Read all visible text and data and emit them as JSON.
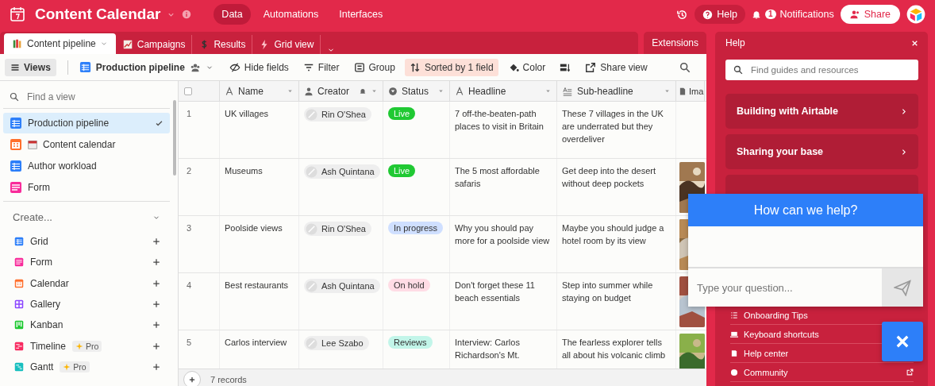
{
  "app": {
    "title": "Content Calendar",
    "nav": [
      {
        "label": "Data",
        "selected": true
      },
      {
        "label": "Automations",
        "selected": false
      },
      {
        "label": "Interfaces",
        "selected": false
      }
    ],
    "help_button": "Help",
    "notifications": {
      "count": "1",
      "label": "Notifications"
    },
    "share_button": "Share"
  },
  "table_tabs": [
    {
      "kind": "books",
      "label": "Content pipeline",
      "selected": true
    },
    {
      "kind": "chart",
      "label": "Campaigns",
      "selected": false
    },
    {
      "kind": "coin",
      "label": "Results",
      "selected": false
    },
    {
      "kind": "bolt",
      "label": "Grid view",
      "selected": false
    }
  ],
  "extensions_tab": "Extensions",
  "toolbar": {
    "views_button": "Views",
    "current_view": "Production pipeline",
    "actions": [
      {
        "kind": "hide",
        "label": "Hide fields",
        "active": false
      },
      {
        "kind": "filter",
        "label": "Filter",
        "active": false
      },
      {
        "kind": "group",
        "label": "Group",
        "active": false
      },
      {
        "kind": "sort",
        "label": "Sorted by 1 field",
        "active": true
      },
      {
        "kind": "color",
        "label": "Color",
        "active": false
      },
      {
        "kind": "rowheight",
        "active": false
      },
      {
        "kind": "share",
        "label": "Share view",
        "active": false
      }
    ]
  },
  "sidebar": {
    "search_placeholder": "Find a view",
    "views": [
      {
        "kind": "grid",
        "label": "Production pipeline",
        "selected": true
      },
      {
        "kind": "calendar",
        "label": "Content calendar",
        "selected": false
      },
      {
        "kind": "grid",
        "label": "Author workload",
        "selected": false
      },
      {
        "kind": "form",
        "label": "Form",
        "selected": false
      }
    ],
    "create_label": "Create...",
    "create_items": [
      {
        "kind": "grid",
        "label": "Grid"
      },
      {
        "kind": "form",
        "label": "Form"
      },
      {
        "kind": "calendar",
        "label": "Calendar"
      },
      {
        "kind": "gallery",
        "label": "Gallery"
      },
      {
        "kind": "kanban",
        "label": "Kanban"
      },
      {
        "kind": "timeline",
        "label": "Timeline",
        "badge": "Pro"
      },
      {
        "kind": "gantt",
        "label": "Gantt",
        "badge": "Pro"
      }
    ]
  },
  "table": {
    "columns": [
      {
        "kind": "text",
        "label": "Name"
      },
      {
        "kind": "user",
        "label": "Creator"
      },
      {
        "kind": "status",
        "label": "Status"
      },
      {
        "kind": "text",
        "label": "Headline"
      },
      {
        "kind": "longtext",
        "label": "Sub-headline"
      },
      {
        "kind": "attachment",
        "label": "Ima"
      }
    ],
    "rows": [
      {
        "number": "1",
        "name": "UK villages",
        "creator": "Rin O'Shea",
        "status": {
          "label": "Live",
          "color": "#20c933"
        },
        "headline": "7 off-the-beaten-path places to visit in Britain",
        "subheadline": "These 7 villages in the UK are underrated but they overdeliver"
      },
      {
        "number": "2",
        "name": "Museums",
        "creator": "Ash Quintana",
        "status": {
          "label": "Live",
          "color": "#20c933"
        },
        "headline": "The 5 most affordable safaris",
        "subheadline": "Get deep into the desert without deep pockets"
      },
      {
        "number": "3",
        "name": "Poolside views",
        "creator": "Rin O'Shea",
        "status": {
          "label": "In progress",
          "color": "#cfdfff"
        },
        "headline": "Why you should pay more for a poolside view",
        "subheadline": "Maybe you should judge a hotel room by its view"
      },
      {
        "number": "4",
        "name": "Best restaurants",
        "creator": "Ash Quintana",
        "status": {
          "label": "On hold",
          "color": "#ffdce5"
        },
        "headline": "Don't forget these 11 beach essentials",
        "subheadline": "Step into summer while staying on budget"
      },
      {
        "number": "5",
        "name": "Carlos interview",
        "creator": "Lee Szabo",
        "status": {
          "label": "Reviews",
          "color": "#c2f5e9"
        },
        "headline": "Interview: Carlos Richardson's Mt.",
        "subheadline": "The fearless explorer tells all about his volcanic climb"
      }
    ],
    "record_count": "7 records"
  },
  "help_panel": {
    "title": "Help",
    "search_placeholder": "Find guides and resources",
    "cards": [
      "Building with Airtable",
      "Sharing your base"
    ],
    "links": [
      {
        "kind": "tips",
        "label": "Onboarding Tips",
        "external": false
      },
      {
        "kind": "keyboard",
        "label": "Keyboard shortcuts",
        "external": false
      },
      {
        "kind": "book",
        "label": "Help center",
        "external": false
      },
      {
        "kind": "community",
        "label": "Community",
        "external": true
      }
    ]
  },
  "chat_widget": {
    "title": "How can we help?",
    "placeholder": "Type your question..."
  }
}
